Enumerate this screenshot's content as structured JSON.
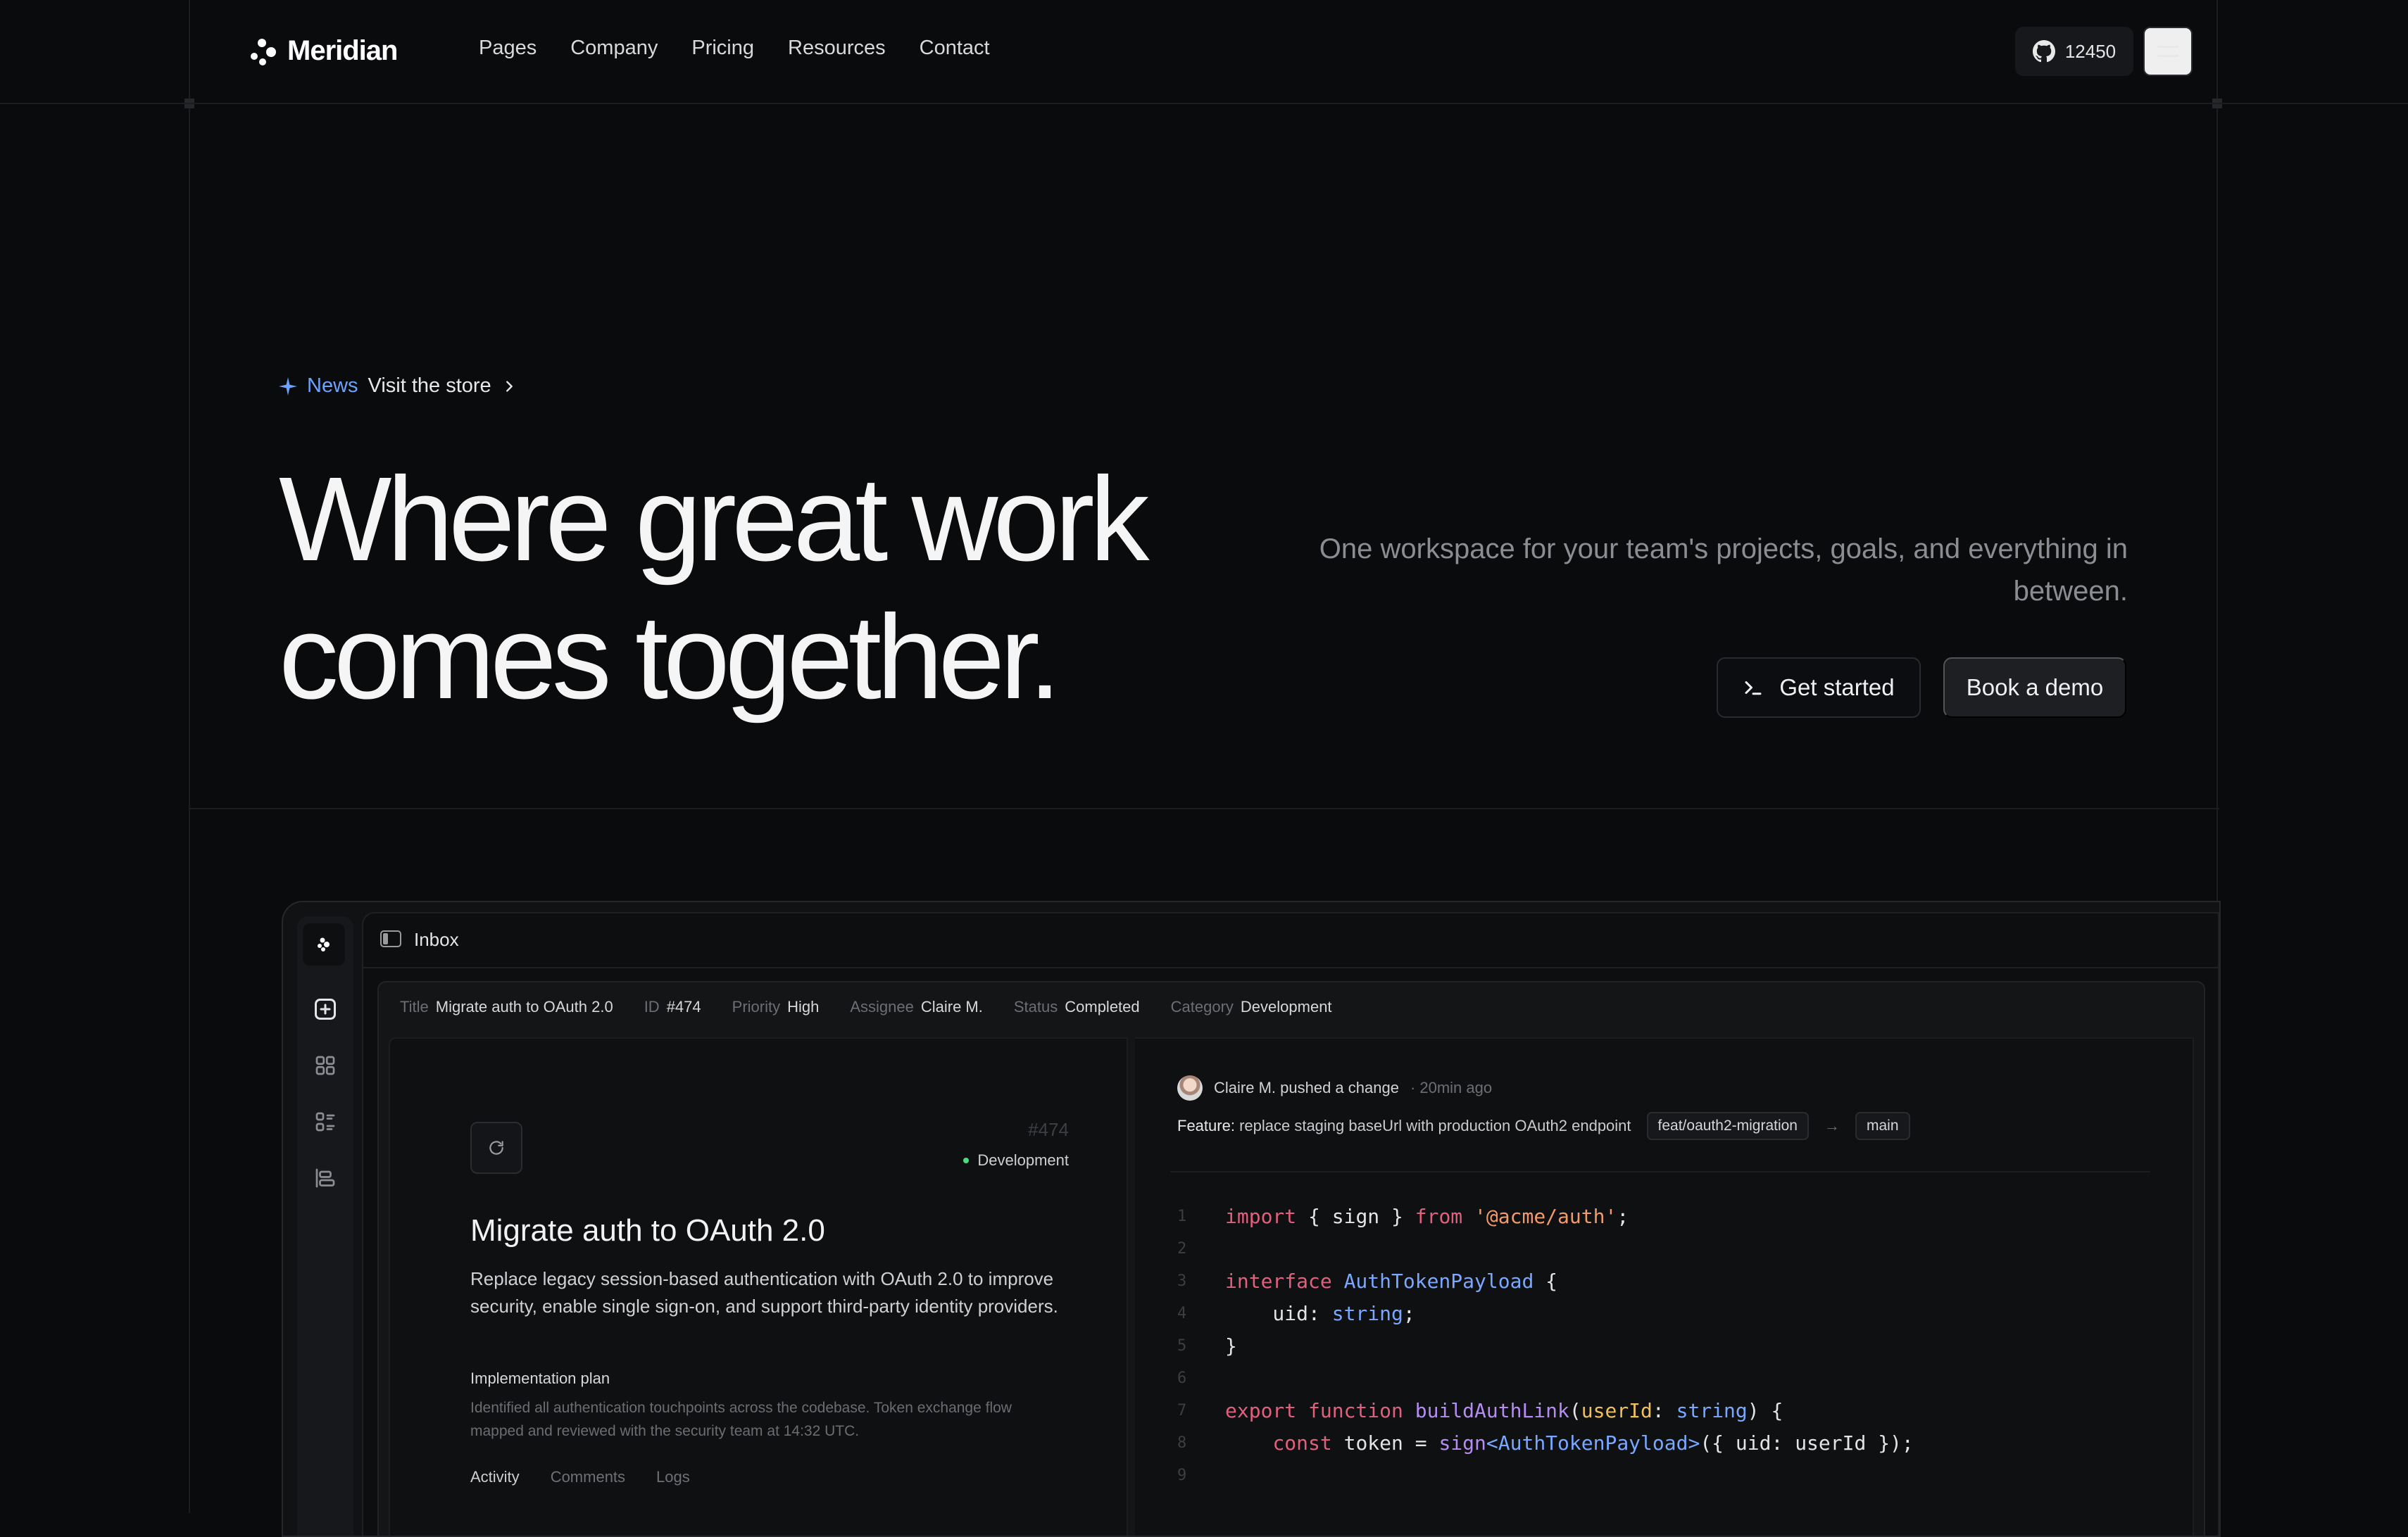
{
  "brand": {
    "name": "Meridian"
  },
  "nav": {
    "links": [
      "Pages",
      "Company",
      "Pricing",
      "Resources",
      "Contact"
    ],
    "github_stars": "12450"
  },
  "hero": {
    "news_tag": "News",
    "news_text": "Visit the store",
    "title_line1": "Where great work",
    "title_line2": "comes together.",
    "subtitle": "One workspace for your team's projects, goals, and everything in between.",
    "primary_cta": "Get started",
    "secondary_cta": "Book a demo"
  },
  "app": {
    "topbar_title": "Inbox",
    "meta": [
      {
        "key": "Title",
        "value": "Migrate auth to OAuth 2.0"
      },
      {
        "key": "ID",
        "value": "#474"
      },
      {
        "key": "Priority",
        "value": "High"
      },
      {
        "key": "Assignee",
        "value": "Claire M."
      },
      {
        "key": "Status",
        "value": "Completed"
      },
      {
        "key": "Category",
        "value": "Development"
      }
    ],
    "issue": {
      "number": "#474",
      "category": "Development",
      "title": "Migrate auth to OAuth 2.0",
      "description": "Replace legacy session-based authentication with OAuth 2.0 to improve security, enable single sign-on, and support third-party identity providers.",
      "plan_label": "Implementation plan",
      "plan_text": "Identified all authentication touchpoints across the codebase. Token exchange flow mapped and reviewed with the security team at 14:32 UTC.",
      "tabs": [
        "Activity",
        "Comments",
        "Logs"
      ]
    },
    "commit": {
      "author_action": "Claire M. pushed a change",
      "time": "· 20min ago",
      "feature_label": "Feature:",
      "feature_text": "replace staging baseUrl with production OAuth2 endpoint",
      "branch_from": "feat/oauth2-migration",
      "arrow": "→",
      "branch_to": "main"
    },
    "code_line_numbers": [
      "1",
      "2",
      "3",
      "4",
      "5",
      "6",
      "7",
      "8",
      "9"
    ]
  },
  "colors": {
    "background": "#0a0b0d",
    "accent": "#6ea2ff",
    "keyword": "#e0607e",
    "type": "#7aa7ff",
    "string": "#f39a6b",
    "function": "#b58cf2",
    "status_dot": "#4ade80"
  },
  "icons": [
    "meridian-logo-icon",
    "github-icon",
    "menu-icon",
    "sparkle-icon",
    "chevron-right-icon",
    "terminal-icon",
    "sidebar-toggle-icon",
    "plus-square-icon",
    "grid-icon",
    "list-icon",
    "align-icon",
    "refresh-icon"
  ]
}
